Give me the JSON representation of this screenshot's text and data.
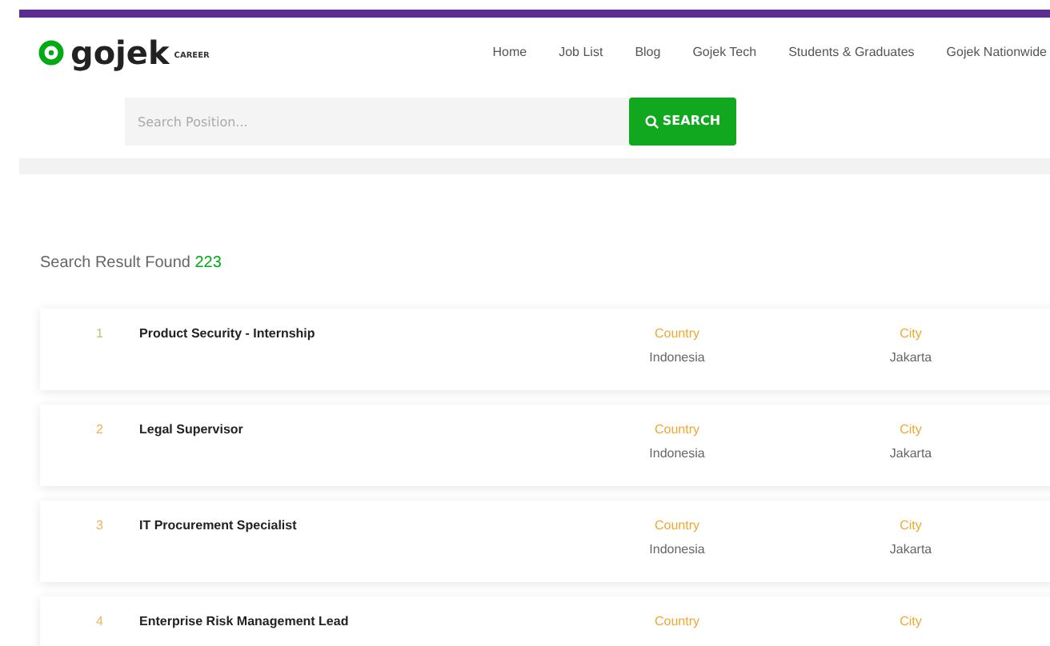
{
  "header": {
    "logo": "gojek",
    "logo_sub": "CAREER",
    "nav": [
      {
        "label": "Home"
      },
      {
        "label": "Job List"
      },
      {
        "label": "Blog"
      },
      {
        "label": "Gojek Tech"
      },
      {
        "label": "Students & Graduates"
      },
      {
        "label": "Gojek Nationwide"
      }
    ]
  },
  "search": {
    "placeholder": "Search Position...",
    "button": "SEARCH"
  },
  "results": {
    "label": "Search Result Found",
    "count": "223"
  },
  "jobs": [
    {
      "number": "1",
      "color": "#b5c86a",
      "title": "Product Security - Internship",
      "country_label": "Country",
      "country": "Indonesia",
      "city_label": "City",
      "city": "Jakarta"
    },
    {
      "number": "2",
      "color": "#f0b060",
      "title": "Legal Supervisor",
      "country_label": "Country",
      "country": "Indonesia",
      "city_label": "City",
      "city": "Jakarta"
    },
    {
      "number": "3",
      "color": "#f0b060",
      "title": "IT Procurement Specialist",
      "country_label": "Country",
      "country": "Indonesia",
      "city_label": "City",
      "city": "Jakarta"
    },
    {
      "number": "4",
      "color": "#f0b060",
      "title": "Enterprise Risk Management Lead",
      "country_label": "Country",
      "city_label": "City"
    }
  ]
}
